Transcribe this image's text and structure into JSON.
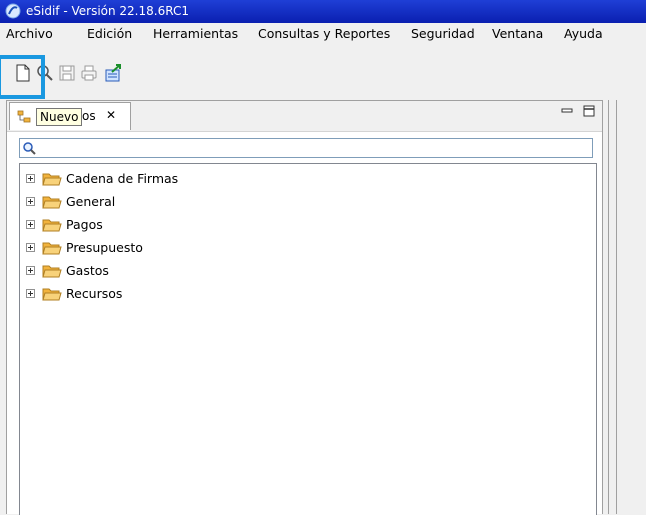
{
  "window": {
    "title": "eSidif - Versión 22.18.6RC1"
  },
  "menu": [
    "Archivo",
    "Edición",
    "Herramientas",
    "Consultas y Reportes",
    "Seguridad",
    "Ventana",
    "Ayuda"
  ],
  "toolbar": {
    "buttons": [
      "new-document-icon",
      "search-icon",
      "save-icon",
      "print-icon",
      "export-icon"
    ],
    "tooltip": "Nuevo"
  },
  "view": {
    "tab_title_suffix": "os",
    "tab_close": "✕",
    "search": {
      "value": "",
      "placeholder": ""
    },
    "tree": [
      {
        "label": "Cadena de Firmas"
      },
      {
        "label": "General"
      },
      {
        "label": "Pagos"
      },
      {
        "label": "Presupuesto"
      },
      {
        "label": "Gastos"
      },
      {
        "label": "Recursos"
      }
    ]
  },
  "colors": {
    "titlebar": "#0a1fb0",
    "highlight": "#1a98e0",
    "folder": "#f2b33d"
  }
}
